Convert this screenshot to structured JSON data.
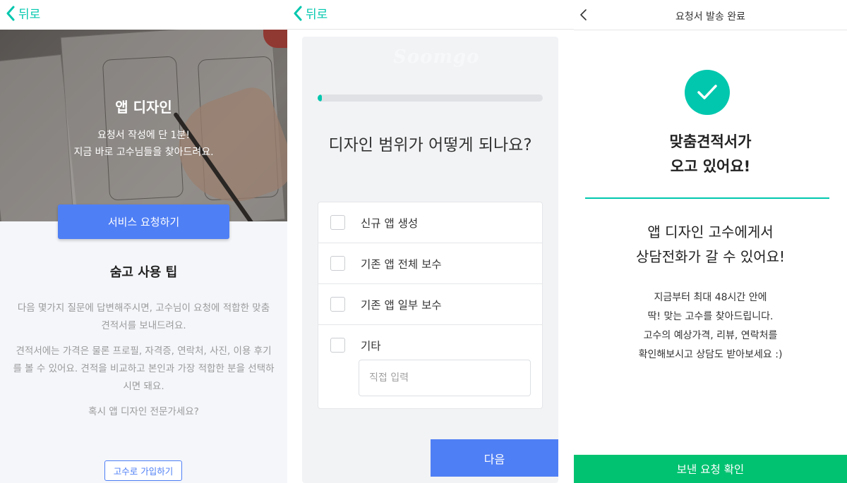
{
  "screen1": {
    "back_label": "뒤로",
    "hero": {
      "title": "앱 디자인",
      "subtitle_lines": [
        "요청서 작성에 단 1분!",
        "지금 바로 고수님들을 찾아드려요."
      ]
    },
    "request_button": "서비스 요청하기",
    "tips": {
      "title": "숨고 사용 팁",
      "paragraphs": [
        "다음 몇가지 질문에 답변해주시면, 고수님이 요청에 적합한 맞춤 견적서를 보내드려요.",
        "견적서에는 가격은 물론 프로필, 자격증, 연락처, 사진, 이용 후기를 볼 수 있어요. 견적을 비교하고 본인과 가장 적합한 분을 선택하시면 돼요.",
        "혹시 앱 디자인 전문가세요?"
      ]
    },
    "join_button": "고수로 가입하기"
  },
  "screen2": {
    "back_label": "뒤로",
    "watermark": "Soomgo",
    "progress": 0.02,
    "question": "디자인 범위가 어떻게 되나요?",
    "options": [
      {
        "label": "신규 앱 생성",
        "checked": false
      },
      {
        "label": "기존 앱 전체 보수",
        "checked": false
      },
      {
        "label": "기존 앱 일부 보수",
        "checked": false
      },
      {
        "label": "기타",
        "checked": false
      }
    ],
    "other_placeholder": "직접 입력",
    "next_button": "다음"
  },
  "screen3": {
    "title": "요청서 발송 완료",
    "headline_lines": [
      "맞춤견적서가",
      "오고 있어요!"
    ],
    "message_lines": [
      "앱 디자인 고수에게서",
      "상담전화가 갈 수 있어요!"
    ],
    "detail_lines": [
      "지금부터 최대 48시간 안에",
      "딱! 맞는 고수를 찾아드립니다.",
      "고수의 예상가격, 리뷰, 연락처를",
      "확인해보시고 상담도 받아보세요 :)"
    ],
    "confirm_button": "보낸 요청 확인"
  },
  "colors": {
    "accent_teal": "#00c7ae",
    "primary_blue": "#4f7ff5",
    "confirm_green": "#00c270",
    "muted_text": "#9b9b9b"
  },
  "icons": [
    "chevron-left-icon",
    "checkbox-icon",
    "check-icon"
  ]
}
